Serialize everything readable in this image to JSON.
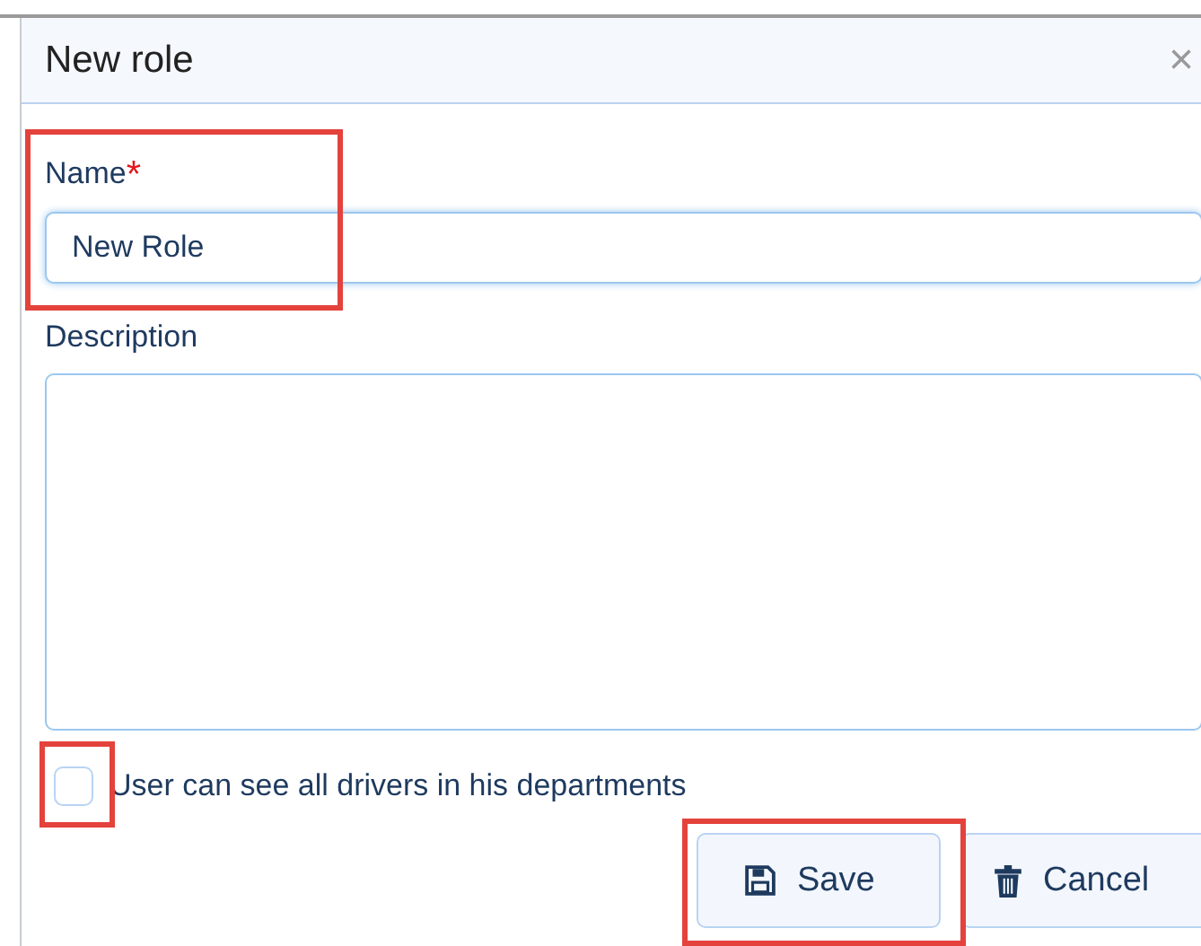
{
  "dialog": {
    "title": "New role",
    "close": "×"
  },
  "name_field": {
    "label": "Name",
    "required_mark": "*",
    "value": "New Role",
    "focused": true,
    "highlighted": true
  },
  "description_field": {
    "label": "Description"
  },
  "checkbox": {
    "label": "User can see all drivers in his departments",
    "checked": false,
    "highlighted": true
  },
  "buttons": [
    {
      "kind": "save",
      "label": "Save",
      "highlighted": true
    },
    {
      "kind": "cancel",
      "label": "Cancel",
      "highlighted": false
    }
  ]
}
